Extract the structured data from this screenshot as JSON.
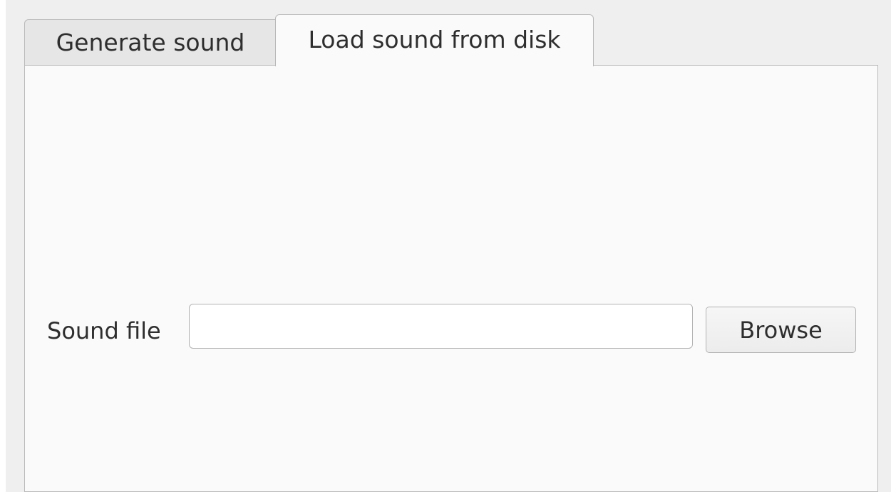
{
  "tabs": [
    {
      "label": "Generate sound",
      "active": false
    },
    {
      "label": "Load sound from disk",
      "active": true
    }
  ],
  "load_panel": {
    "sound_file_label": "Sound file",
    "sound_file_value": "",
    "browse_label": "Browse"
  },
  "colors": {
    "window_bg": "#efefef",
    "panel_bg": "#fafafa",
    "inactive_tab_bg": "#e6e6e6",
    "border": "#b9b9b9",
    "text": "#2e2e2e"
  }
}
